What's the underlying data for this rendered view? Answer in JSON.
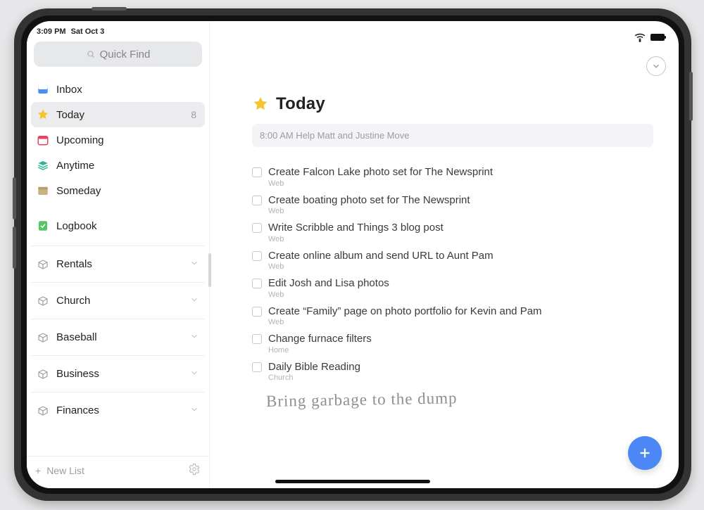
{
  "status": {
    "time": "3:09 PM",
    "date": "Sat Oct 3"
  },
  "search": {
    "placeholder": "Quick Find"
  },
  "sidebar": {
    "items": [
      {
        "label": "Inbox",
        "badge": ""
      },
      {
        "label": "Today",
        "badge": "8"
      },
      {
        "label": "Upcoming",
        "badge": ""
      },
      {
        "label": "Anytime",
        "badge": ""
      },
      {
        "label": "Someday",
        "badge": ""
      },
      {
        "label": "Logbook",
        "badge": ""
      }
    ],
    "areas": [
      {
        "label": "Rentals"
      },
      {
        "label": "Church"
      },
      {
        "label": "Baseball"
      },
      {
        "label": "Business"
      },
      {
        "label": "Finances"
      }
    ],
    "newList": "New List"
  },
  "main": {
    "title": "Today",
    "scheduled": "8:00 AM Help Matt and Justine Move",
    "tasks": [
      {
        "title": "Create Falcon Lake photo set for The Newsprint",
        "category": "Web"
      },
      {
        "title": "Create boating photo set for The Newsprint",
        "category": "Web"
      },
      {
        "title": "Write Scribble and Things 3 blog post",
        "category": "Web"
      },
      {
        "title": "Create online album and send URL to Aunt Pam",
        "category": "Web"
      },
      {
        "title": "Edit Josh and Lisa photos",
        "category": "Web"
      },
      {
        "title": "Create “Family” page on photo portfolio for Kevin and Pam",
        "category": "Web"
      },
      {
        "title": "Change furnace filters",
        "category": "Home"
      },
      {
        "title": "Daily Bible Reading",
        "category": "Church"
      }
    ],
    "handwriting": "Bring garbage to the dump"
  }
}
